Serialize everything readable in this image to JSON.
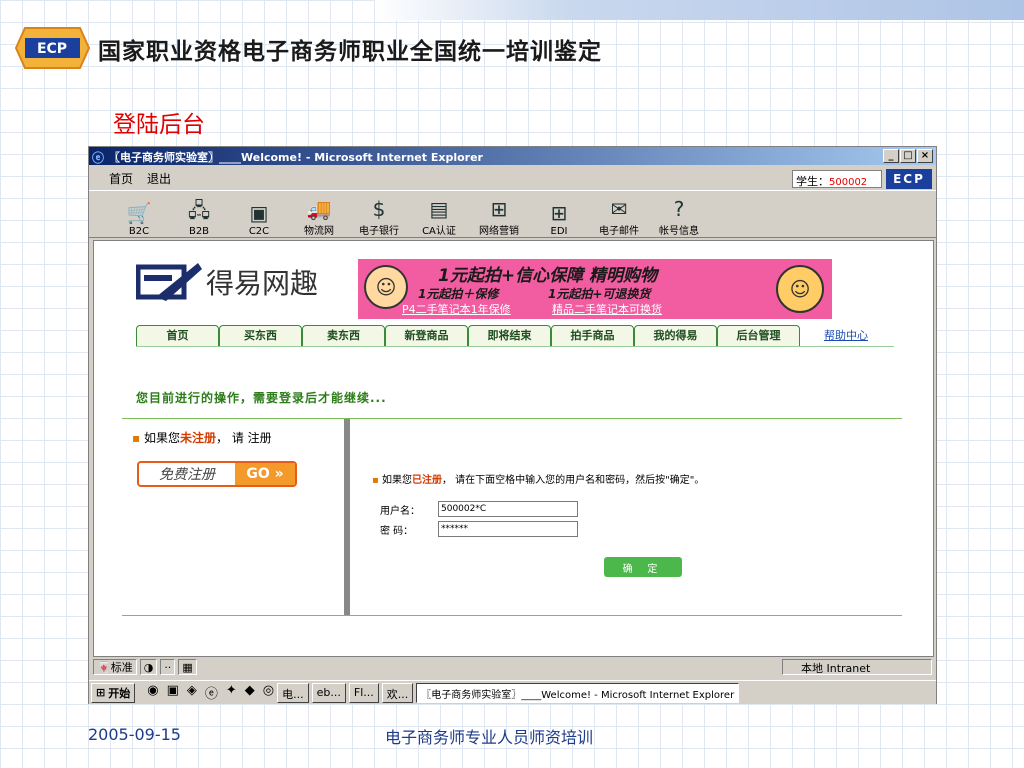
{
  "slide": {
    "title": "国家职业资格电子商务师职业全国统一培训鉴定",
    "subtitle": "登陆后台",
    "footer_date": "2005-09-15",
    "footer_text": "电子商务师专业人员师资培训",
    "logo_text": "ECP"
  },
  "window": {
    "title": "〖电子商务师实验室〗____Welcome! - Microsoft Internet Explorer",
    "min_label": "_",
    "max_label": "□",
    "close_label": "×"
  },
  "menubar": {
    "items": [
      "首页",
      "退出"
    ],
    "student_label": "学生：",
    "student_id": "500002",
    "ecp_label": "ECP"
  },
  "toolbar": {
    "items": [
      {
        "label": "B2C",
        "icon": "cart-icon"
      },
      {
        "label": "B2B",
        "icon": "network-icon"
      },
      {
        "label": "C2C",
        "icon": "c2c-icon"
      },
      {
        "label": "物流网",
        "icon": "truck-icon"
      },
      {
        "label": "电子银行",
        "icon": "bank-icon"
      },
      {
        "label": "CA认证",
        "icon": "certificate-icon"
      },
      {
        "label": "网络营销",
        "icon": "marketing-icon"
      },
      {
        "label": "EDI",
        "icon": "edi-icon"
      },
      {
        "label": "电子邮件",
        "icon": "email-icon"
      },
      {
        "label": "帐号信息",
        "icon": "help-icon"
      }
    ]
  },
  "site": {
    "logo_text": "得易网趣",
    "banner": {
      "line1": "1元起拍+信心保障 精明购物",
      "line2a": "1元起拍＋保修",
      "line2b": "1元起拍+可退换货",
      "link1": "P4二手笔记本1年保修",
      "link2": "精品二手笔记本可换货"
    },
    "nav": [
      "首页",
      "买东西",
      "卖东西",
      "新登商品",
      "即将结束",
      "拍手商品",
      "我的得易",
      "后台管理"
    ],
    "help": "帮助中心",
    "prompt": "您目前进行的操作，需要登录后才能继续...",
    "left_text_pre": "如果您",
    "left_text_em": "未注册",
    "left_text_post": "，  请 注册",
    "register_label": "免费注册",
    "go_label": "GO »",
    "right_text_pre": "如果您",
    "right_text_em": "已注册",
    "right_text_post": "， 请在下面空格中输入您的用户名和密码，然后按\"确定\"。",
    "username_label": "用户名：",
    "username_value": "500002*C",
    "password_label": "密  码：",
    "password_value": "******",
    "ok_label": "确 定"
  },
  "statusbar": {
    "ime_label": "标准",
    "zone": "本地 Intranet"
  },
  "taskbar": {
    "start": "开始",
    "tasks": [
      "电...",
      "eb...",
      "Fl...",
      "欢..."
    ],
    "active_task": "〖电子商务师实验室〗____Welcome! - Microsoft Internet Explorer"
  }
}
